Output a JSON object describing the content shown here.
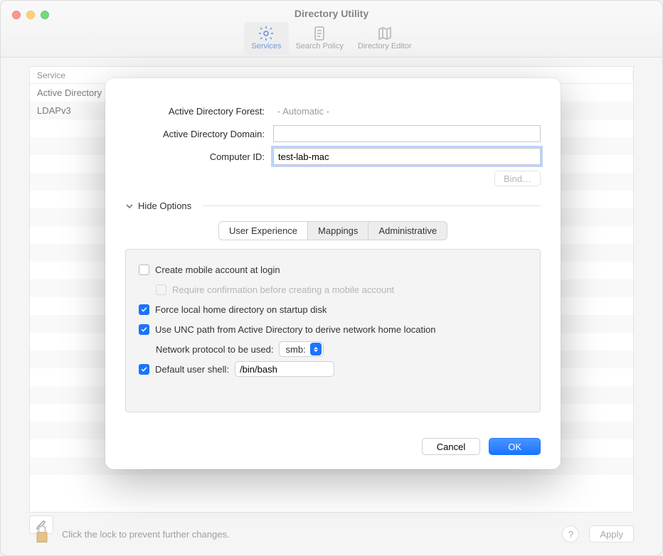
{
  "window": {
    "title": "Directory Utility",
    "toolbar": [
      {
        "label": "Services",
        "icon": "gear-icon",
        "active": true
      },
      {
        "label": "Search Policy",
        "icon": "document-icon",
        "active": false
      },
      {
        "label": "Directory Editor",
        "icon": "map-icon",
        "active": false
      }
    ]
  },
  "table": {
    "header": {
      "service": "Service"
    },
    "rows": [
      {
        "label": "Active Directory",
        "selected": true
      },
      {
        "label": "LDAPv3",
        "selected": false
      }
    ]
  },
  "footer": {
    "lock_hint": "Click the lock to prevent further changes.",
    "help_label": "?",
    "apply_label": "Apply"
  },
  "sheet": {
    "fields": {
      "forest_label": "Active Directory Forest:",
      "forest_value": "- Automatic -",
      "domain_label": "Active Directory Domain:",
      "domain_value": "",
      "computer_label": "Computer ID:",
      "computer_value": "test-lab-mac"
    },
    "bind_label": "Bind…",
    "options_toggle_label": "Hide Options",
    "tabs": [
      {
        "label": "User Experience",
        "active": true
      },
      {
        "label": "Mappings",
        "active": false
      },
      {
        "label": "Administrative",
        "active": false
      }
    ],
    "user_experience": {
      "create_mobile": {
        "label": "Create mobile account at login",
        "checked": false
      },
      "require_confirm": {
        "label": "Require confirmation before creating a mobile account",
        "checked": false,
        "disabled": true
      },
      "force_local": {
        "label": "Force local home directory on startup disk",
        "checked": true
      },
      "use_unc": {
        "label": "Use UNC path from Active Directory to derive network home location",
        "checked": true
      },
      "protocol_label": "Network protocol to be used:",
      "protocol_value": "smb:",
      "default_shell": {
        "label": "Default user shell:",
        "checked": true,
        "value": "/bin/bash"
      }
    },
    "buttons": {
      "cancel": "Cancel",
      "ok": "OK"
    }
  }
}
